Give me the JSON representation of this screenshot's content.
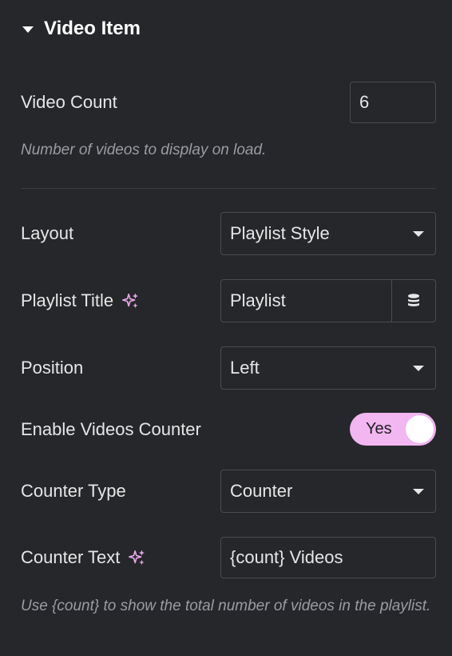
{
  "section": {
    "title": "Video Item"
  },
  "video_count": {
    "label": "Video Count",
    "value": "6",
    "hint": "Number of videos to display on load."
  },
  "layout": {
    "label": "Layout",
    "value": "Playlist Style"
  },
  "playlist_title": {
    "label": "Playlist Title",
    "value": "Playlist"
  },
  "position": {
    "label": "Position",
    "value": "Left"
  },
  "videos_counter": {
    "label": "Enable Videos Counter",
    "toggle_label": "Yes",
    "enabled": true
  },
  "counter_type": {
    "label": "Counter Type",
    "value": "Counter"
  },
  "counter_text": {
    "label": "Counter Text",
    "value": "{count} Videos",
    "hint": "Use {count} to show the total number of videos in the playlist."
  },
  "colors": {
    "background": "#26272b",
    "toggle_on": "#f2b6f0",
    "ai_icon": "#e7a6e4"
  }
}
